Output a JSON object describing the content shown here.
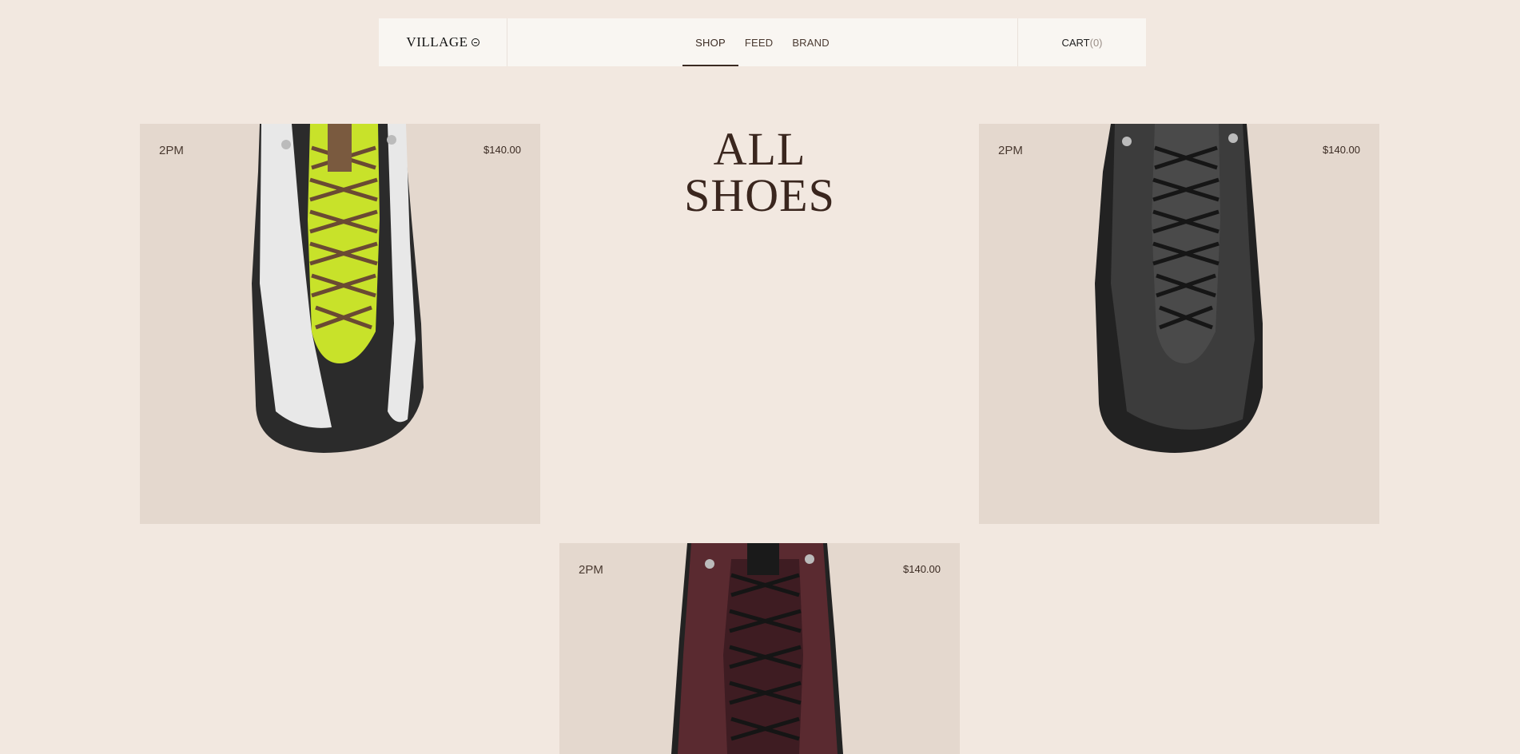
{
  "header": {
    "logo_text": "VILLAGE",
    "nav": [
      "SHOP",
      "FEED",
      "BRAND"
    ],
    "active_nav": "SHOP",
    "cart_label": "CART",
    "cart_count": "(0)"
  },
  "headline": {
    "line1": "ALL",
    "line2": "SHOES"
  },
  "products": [
    {
      "name": "2PM",
      "price": "$140.00",
      "colorway": "white-lime"
    },
    {
      "name": "2PM",
      "price": "$140.00",
      "colorway": "black"
    },
    {
      "name": "2PM",
      "price": "$140.00",
      "colorway": "burgundy"
    }
  ],
  "colors": {
    "page_bg": "#f2e8e0",
    "header_bg": "#f9f6f2",
    "card_bg": "#e4d8ce",
    "text": "#3a2a22"
  }
}
